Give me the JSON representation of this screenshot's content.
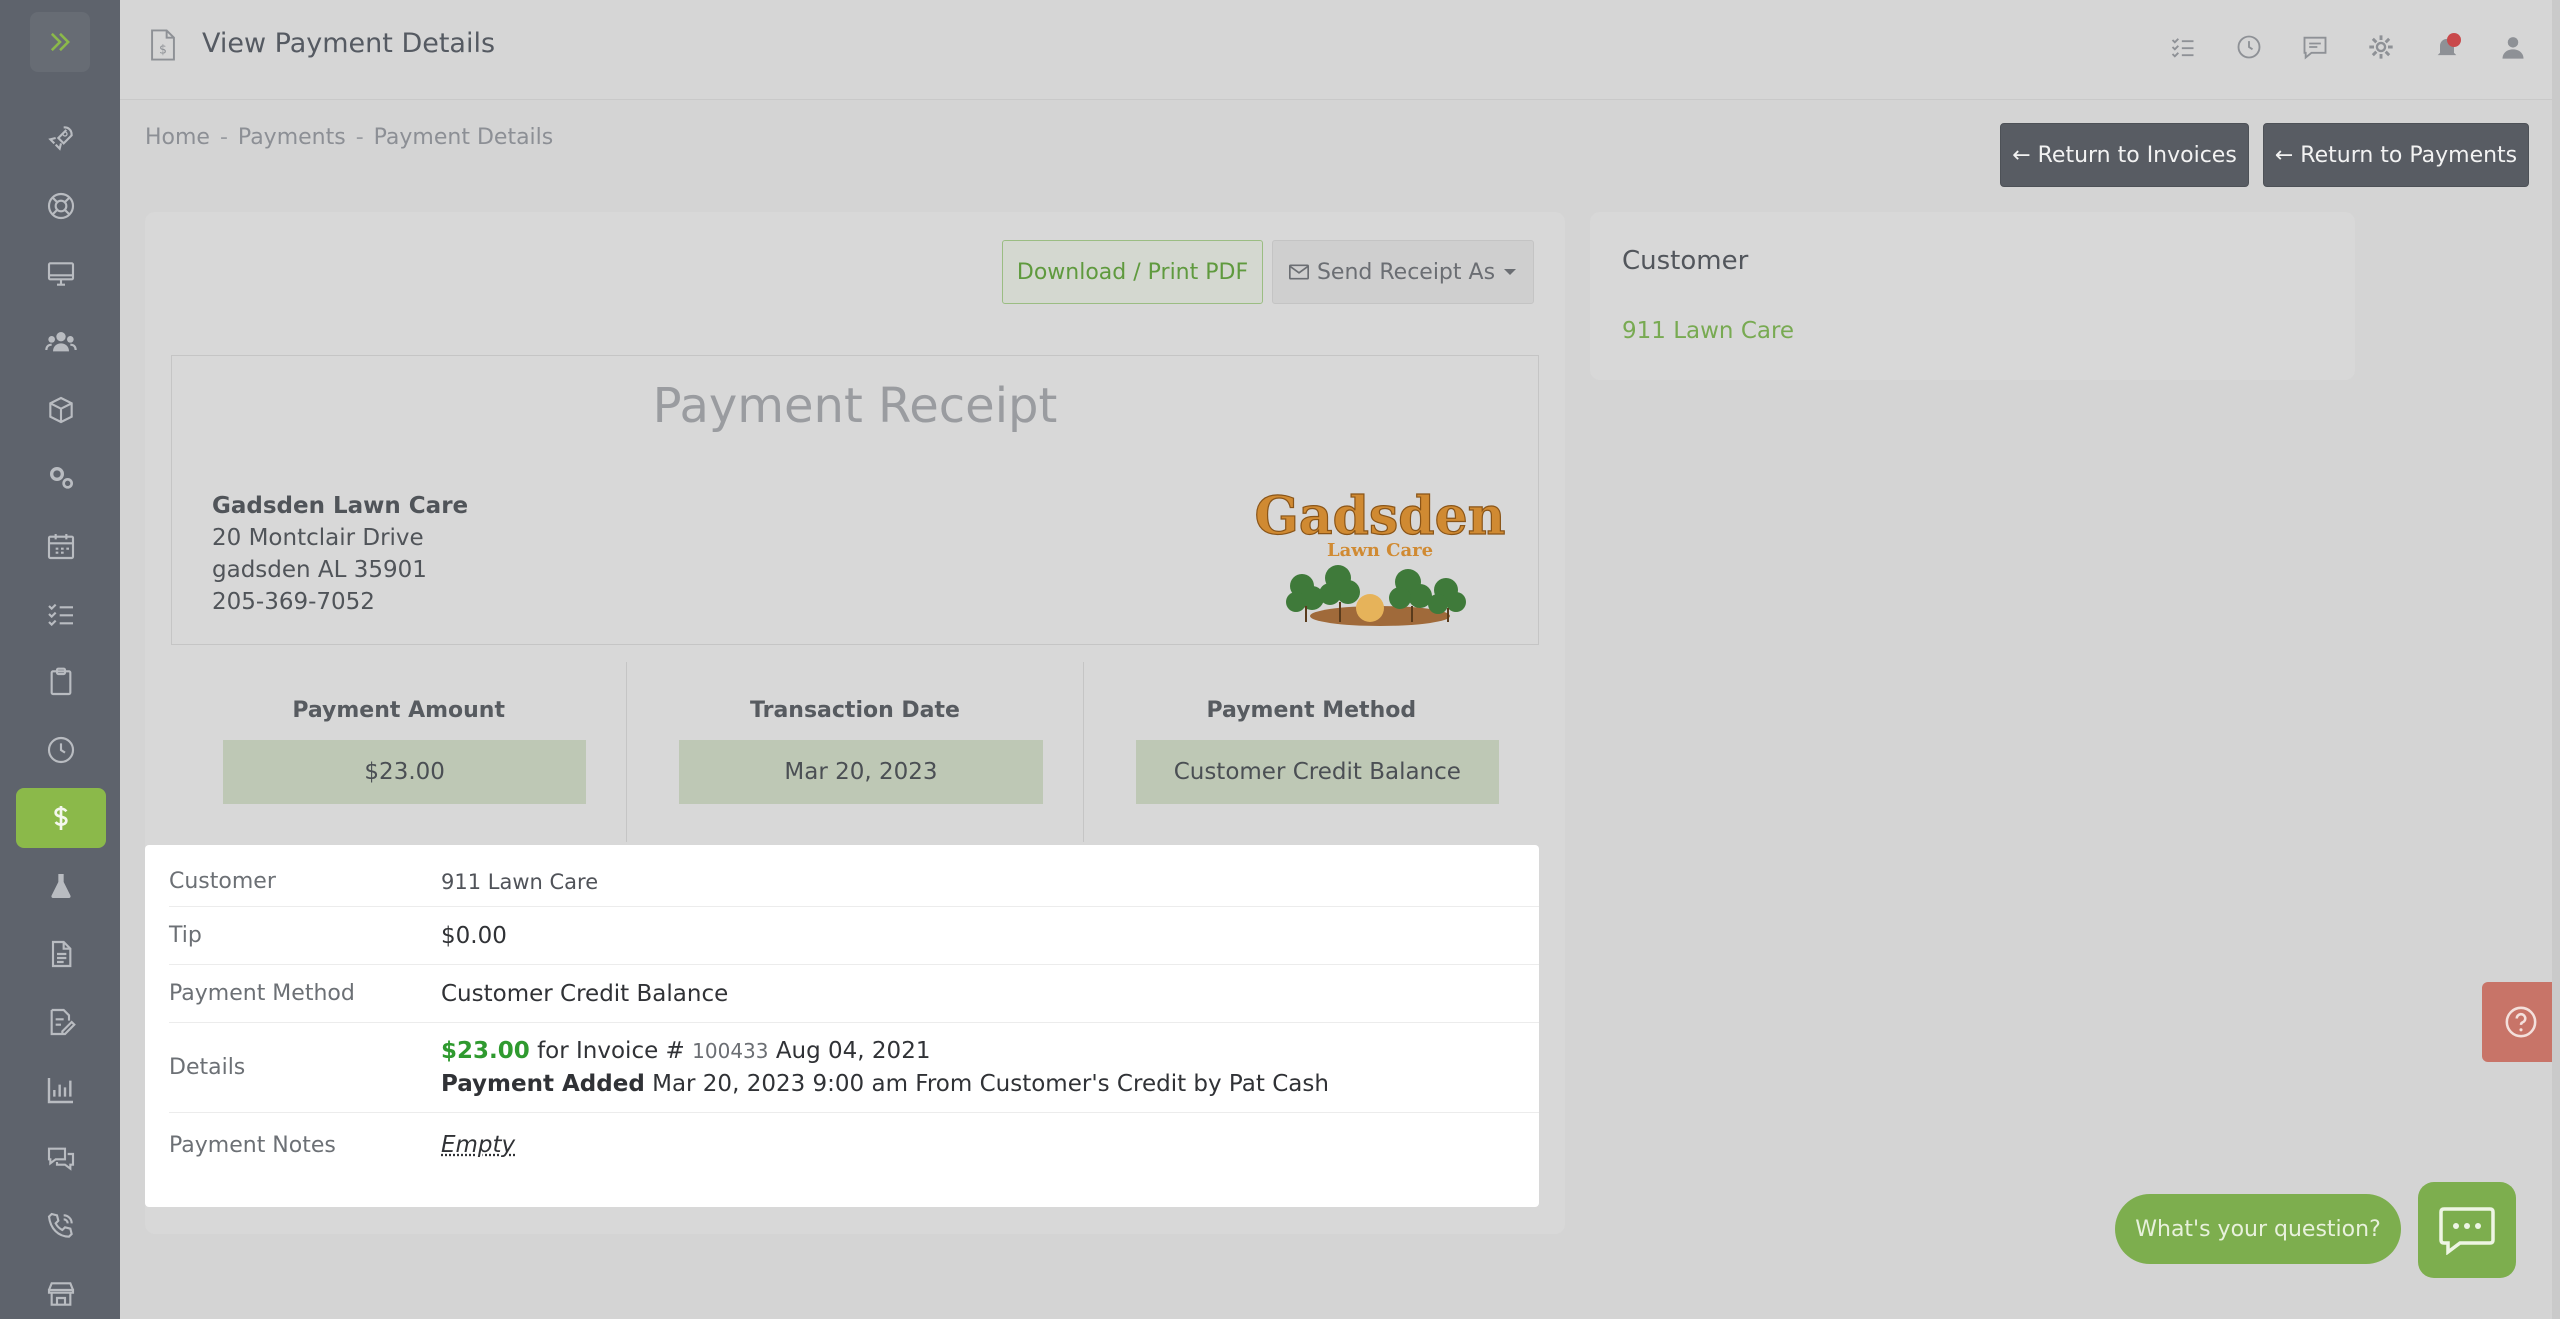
{
  "header": {
    "title": "View Payment Details",
    "icons": [
      "tasks-icon",
      "clock-icon",
      "chat-icon",
      "gear-icon",
      "bell-icon",
      "user-icon"
    ]
  },
  "sidebar": {
    "items": [
      "rocket-icon",
      "support-icon",
      "monitor-icon",
      "users-icon",
      "box-icon",
      "cogs-icon",
      "calendar-icon",
      "checklist-icon",
      "clipboard-icon",
      "clock-icon",
      "dollar-icon",
      "flask-icon",
      "file-icon",
      "edit-doc-icon",
      "chart-icon",
      "comments-icon",
      "phone-icon",
      "store-icon"
    ],
    "active": "dollar-icon"
  },
  "breadcrumb": {
    "home": "Home",
    "payments": "Payments",
    "current": "Payment Details",
    "sep": "-"
  },
  "actions": {
    "return_invoices": "← Return to Invoices",
    "return_payments": "← Return to Payments",
    "download_pdf": "Download / Print PDF",
    "send_receipt": "Send Receipt As"
  },
  "receipt": {
    "title": "Payment Receipt",
    "company_name": "Gadsden Lawn Care",
    "address1": "20 Montclair Drive",
    "address2": "gadsden AL 35901",
    "phone": "205-369-7052",
    "logo_text_main": "Gadsden",
    "logo_text_sub": "Lawn Care"
  },
  "summary": {
    "amount_label": "Payment Amount",
    "amount_value": "$23.00",
    "date_label": "Transaction Date",
    "date_value": "Mar 20, 2023",
    "method_label": "Payment Method",
    "method_value": "Customer Credit Balance"
  },
  "details": {
    "customer_label": "Customer",
    "customer_value": "911 Lawn Care",
    "tip_label": "Tip",
    "tip_value": "$0.00",
    "method_label": "Payment Method",
    "method_value": "Customer Credit Balance",
    "details_label": "Details",
    "details_amount": "$23.00",
    "details_for": "for Invoice #",
    "details_invoice": "100433",
    "details_inv_date": "Aug 04, 2021",
    "details_added": "Payment Added",
    "details_added_text": "Mar 20, 2023 9:00 am From Customer's Credit by Pat Cash",
    "notes_label": "Payment Notes",
    "notes_value": "Empty"
  },
  "customer_card": {
    "title": "Customer",
    "name": "911 Lawn Care"
  },
  "chat": {
    "prompt": "What's your question?"
  },
  "colors": {
    "accent_green": "#8bb94a",
    "sidebar": "#5e636c",
    "amount_green": "#2f9a2f",
    "help_red": "#c87468"
  }
}
